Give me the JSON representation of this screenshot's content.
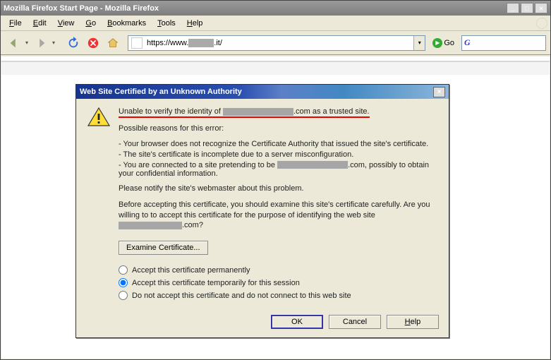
{
  "window": {
    "title": "Mozilla Firefox Start Page - Mozilla Firefox"
  },
  "menu": {
    "file": "File",
    "edit": "Edit",
    "view": "View",
    "go": "Go",
    "bookmarks": "Bookmarks",
    "tools": "Tools",
    "help": "Help"
  },
  "toolbar": {
    "url_value": "https://www.",
    "url_suffix": ".it/",
    "go_label": "Go"
  },
  "dialog": {
    "title": "Web Site Certified by an Unknown Authority",
    "headline_pre": "Unable to verify the identity of ",
    "headline_post": ".com as a trusted site.",
    "reasons_intro": "Possible reasons for this error:",
    "reason1": "- Your browser does not recognize the Certificate Authority that issued the site's certificate.",
    "reason2": "- The site's certificate is incomplete due to a server misconfiguration.",
    "reason3_pre": "- You are connected to a site pretending to be ",
    "reason3_post": ".com, possibly to obtain your confidential information.",
    "notify": "Please notify the site's webmaster about this problem.",
    "before_pre": "Before accepting this certificate, you should examine this site's certificate carefully. Are you willing to to accept this certificate for the purpose of identifying the web site ",
    "before_post": ".com?",
    "examine": "Examine Certificate...",
    "opt_perm": "Accept this certificate permanently",
    "opt_temp": "Accept this certificate temporarily for this session",
    "opt_no": "Do not accept this certificate and do not connect to this web site",
    "ok": "OK",
    "cancel": "Cancel",
    "help": "Help"
  }
}
